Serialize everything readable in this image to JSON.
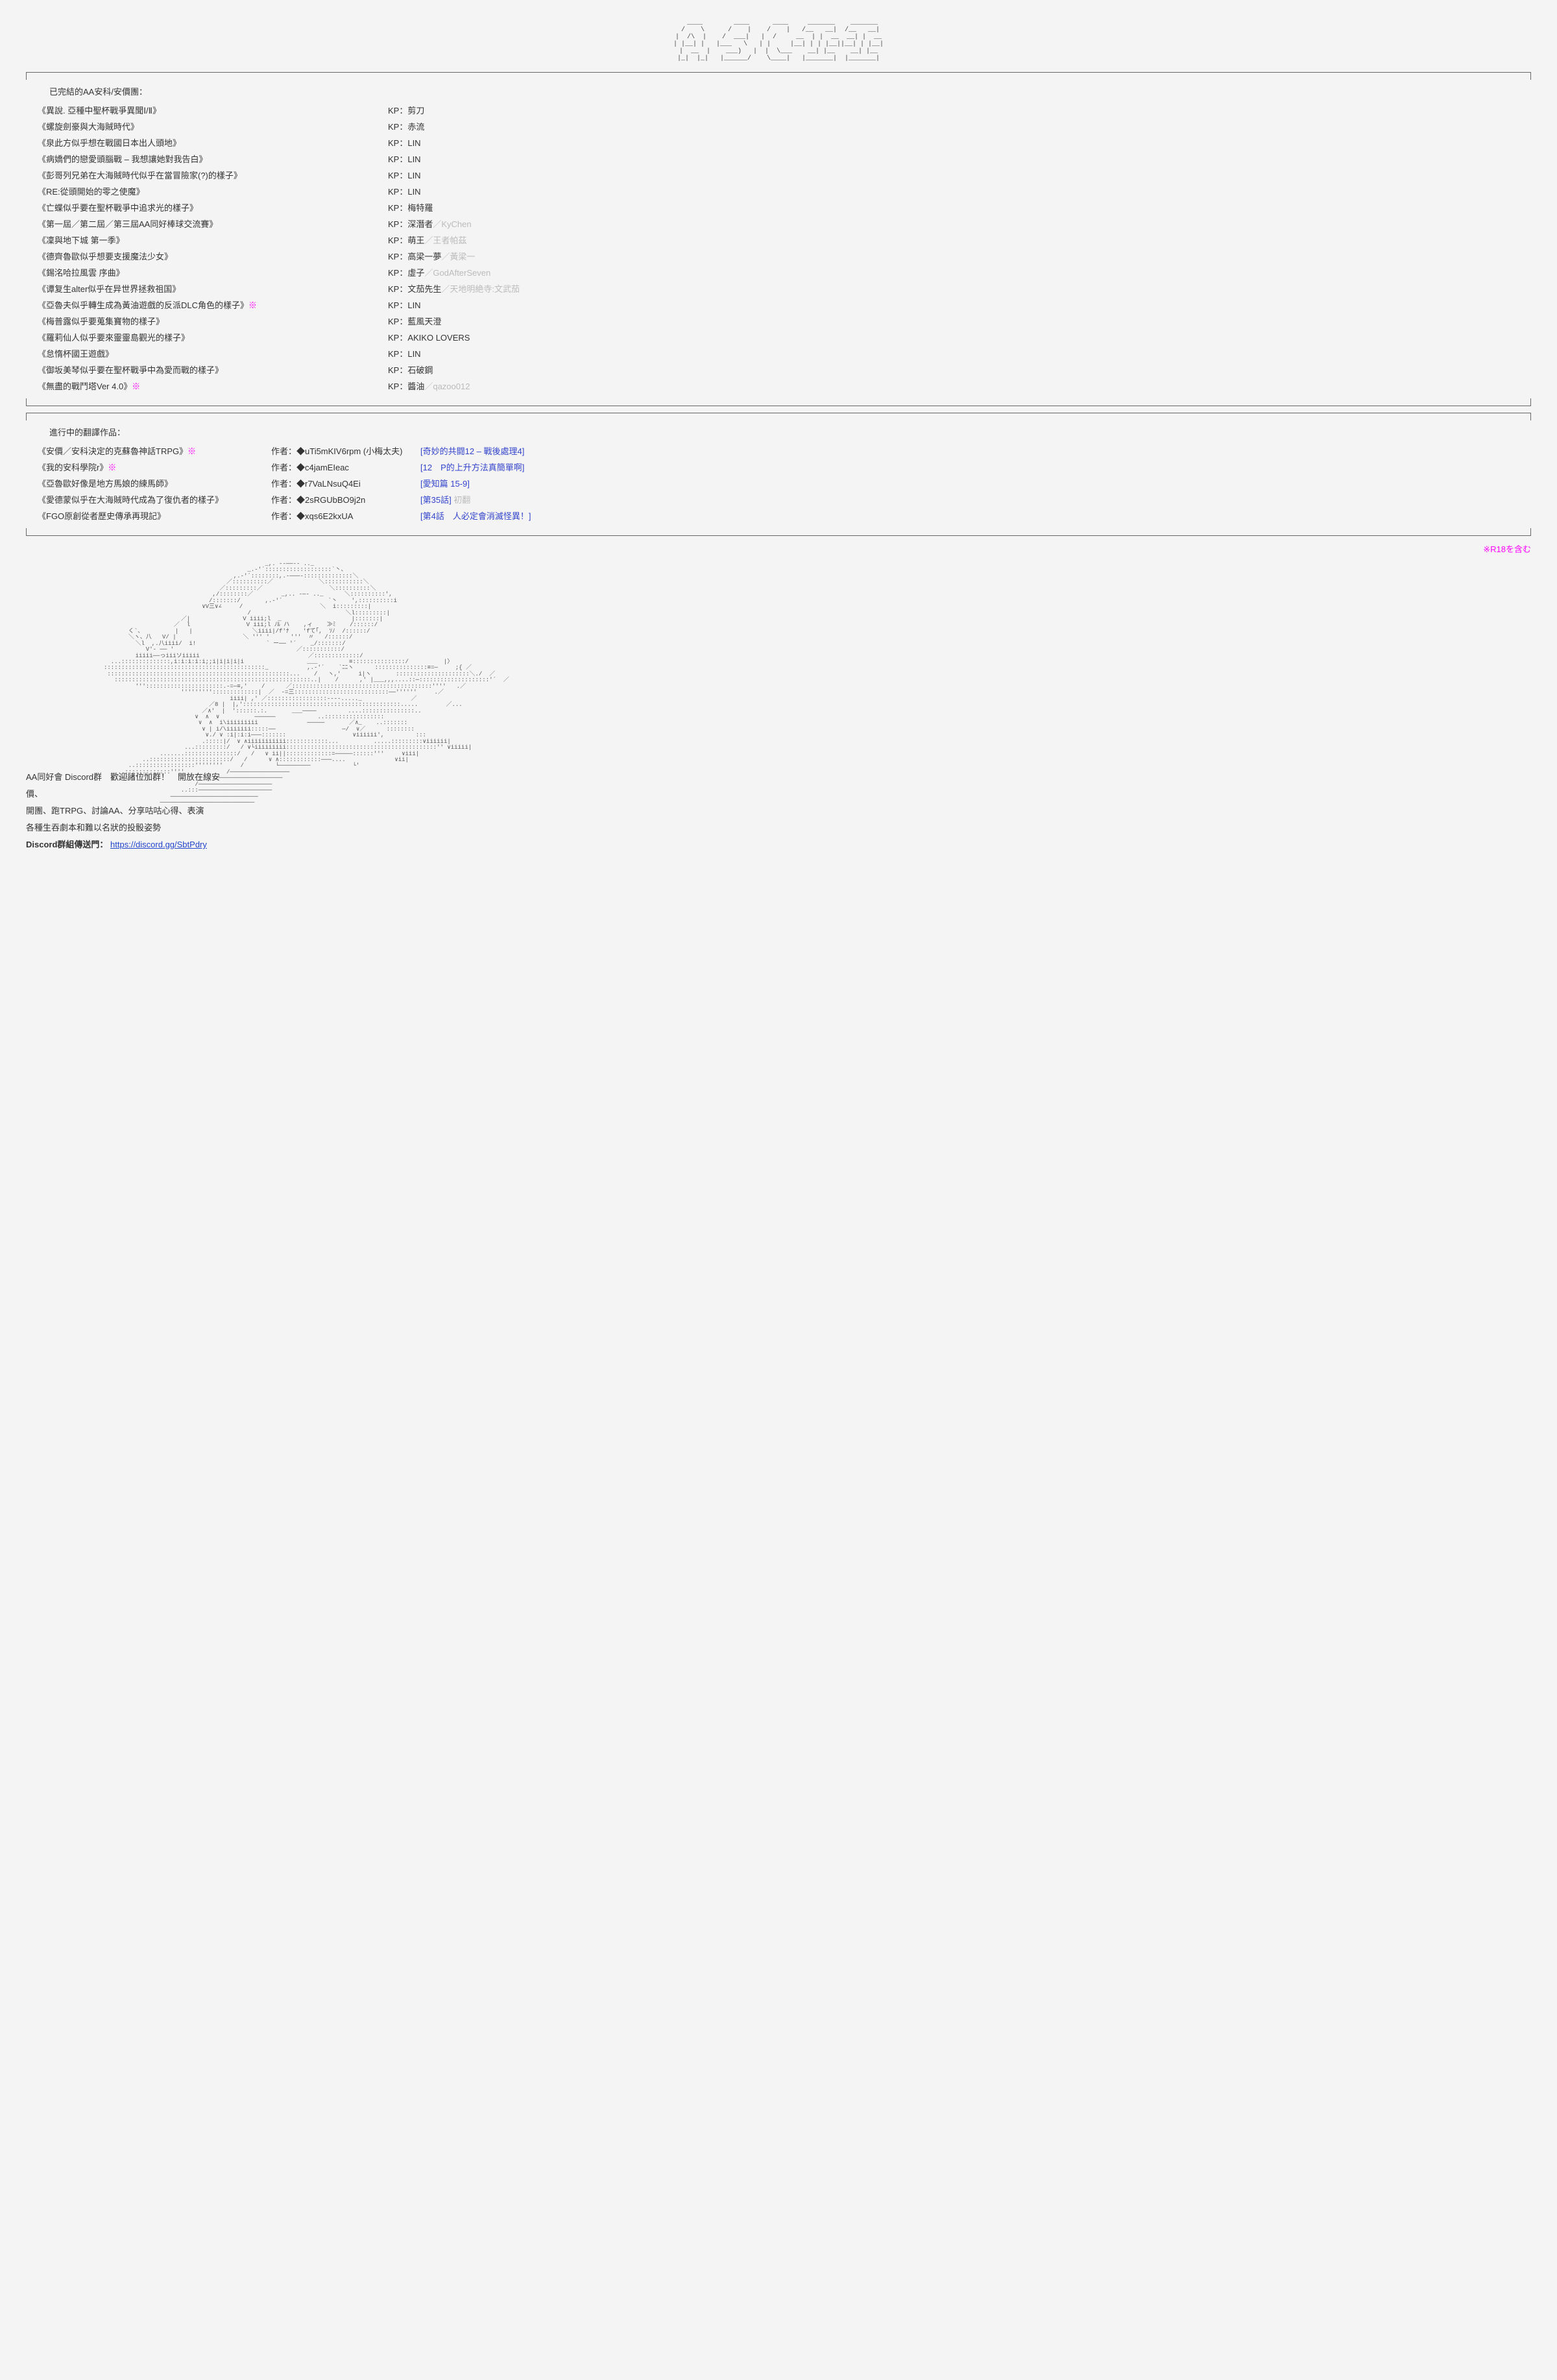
{
  "header_ascii": "   ___    ___   ___   ___   ___ \n  |   |  |     |       |     |  \n  |---|  |---  |       |     |  \n  |   |  |___| |___   _|_   _|_ ",
  "section1": {
    "title": "已完結的AA安科/安價團：",
    "items": [
      {
        "title": "《異說. 亞種中聖杯戰爭異聞Ⅰ/Ⅱ》",
        "r18": false,
        "kp": "KP：剪刀",
        "alt": ""
      },
      {
        "title": "《螺旋劍豪與大海賊時代》",
        "r18": false,
        "kp": "KP：赤流",
        "alt": ""
      },
      {
        "title": "《泉此方似乎想在戰國日本出人頭地》",
        "r18": false,
        "kp": "KP：LIN",
        "alt": ""
      },
      {
        "title": "《病嬌們的戀愛頭腦戰 – 我想讓她對我告白》",
        "r18": false,
        "kp": "KP：LIN",
        "alt": ""
      },
      {
        "title": "《彭哥列兄弟在大海賊時代似乎在當冒險家(?)的樣子》",
        "r18": false,
        "kp": "KP：LIN",
        "alt": ""
      },
      {
        "title": "《RE:從頭開始的零之使魔》",
        "r18": false,
        "kp": "KP：LIN",
        "alt": ""
      },
      {
        "title": "《亡蝶似乎要在聖杯戰爭中追求光的樣子》",
        "r18": false,
        "kp": "KP：梅特羅",
        "alt": ""
      },
      {
        "title": "《第一屆／第二屆／第三屆AA同好棒球交流賽》",
        "r18": false,
        "kp": "KP：深潛者",
        "alt": "／KyChen"
      },
      {
        "title": "《凜與地下城 第一季》",
        "r18": false,
        "kp": "KP：萌王",
        "alt": "／王者帕茲"
      },
      {
        "title": "《德齊魯歐似乎想要支援魔法少女》",
        "r18": false,
        "kp": "KP：高梁一夢",
        "alt": "／黃梁一"
      },
      {
        "title": "《錫洺哈拉風雲 序曲》",
        "r18": false,
        "kp": "KP：虛子",
        "alt": "／GodAfterSeven"
      },
      {
        "title": "《谭复生alter似乎在异世界拯救祖国》",
        "r18": false,
        "kp": "KP：文茄先生",
        "alt": "／天地明絶寺:文武茄"
      },
      {
        "title": "《亞魯夫似乎轉生成為黃油遊戲的反派DLC角色的樣子》",
        "r18": true,
        "kp": "KP：LIN",
        "alt": ""
      },
      {
        "title": "《梅普露似乎要蒐集寶物的樣子》",
        "r18": false,
        "kp": "KP：藍風天澄",
        "alt": ""
      },
      {
        "title": "《羅莉仙人似乎要來靈靈島觀光的樣子》",
        "r18": false,
        "kp": "KP：AKIKO LOVERS",
        "alt": ""
      },
      {
        "title": "《怠惰杯國王遊戲》",
        "r18": false,
        "kp": "KP：LIN",
        "alt": ""
      },
      {
        "title": "《御坂美琴似乎要在聖杯戰爭中為愛而戰的樣子》",
        "r18": false,
        "kp": "KP：石破鋼",
        "alt": ""
      },
      {
        "title": "《無盡的戰鬥塔Ver 4.0》",
        "r18": true,
        "kp": "KP：醬油",
        "alt": "／qazoo012"
      }
    ]
  },
  "section2": {
    "title": "進行中的翻譯作品：",
    "items": [
      {
        "title": "《安價／安科決定的克蘇魯神話TRPG》",
        "r18": true,
        "author": "作者：◆uTi5mKIV6rpm (小梅太夫)",
        "link": "[奇妙的共闘12 – 戰後處理4]",
        "note": ""
      },
      {
        "title": "《我的安科學院r》",
        "r18": true,
        "author": "作者：◆c4jamEIeac",
        "link": "[12　P的上升方法真簡單啊]",
        "note": ""
      },
      {
        "title": "《亞魯歐好像是地方馬娘的練馬師》",
        "r18": false,
        "author": "作者：◆r7VaLNsuQ4Ei",
        "link": "[愛知篇 15-9]",
        "note": ""
      },
      {
        "title": "《愛德蒙似乎在大海賊時代成為了復仇者的樣子》",
        "r18": false,
        "author": "作者：◆2sRGUbBO9j2n",
        "link": "[第35話]",
        "note": " 初翻"
      },
      {
        "title": "《FGO原創從者歷史傳承再現記》",
        "r18": false,
        "author": "作者：◆xqs6E2kxUA",
        "link": "[第4話　人必定會消滅怪異！]",
        "note": ""
      }
    ]
  },
  "r18_note": "※R18を含む",
  "discord": {
    "line1": "AA同好會 Discord群　歡迎諸位加群！　開放在線安價、",
    "line2": "開團、跑TRPG、討論AA、分享咕咕心得、表演",
    "line3": "各種生吞劇本和難以名狀的投骰姿勢",
    "line4_label": "Discord群組傳送門：",
    "link_text": "https://discord.gg/SbtPdry"
  },
  "ascii_art": "                                              _,. --──-- .._\n                                         _.-'´:::::::::::::::::::`丶、\n                                     ,.-'´::::::::,.-───-::::::::::::::＼\n                                   ／::::::::::／             ＼:::::::::::＼\n                                 ／:::::::::／                   ＼::::::::::＼\n                               ,/::::::::／        _,.. -─- .._      ＼::::::::::',\n                              /:::::::/       ,.-'´             `丶    ',::::::::::i\n                            ∨V三∨∠     /                      ＼  i:::::::::|\n                                         /                           ＼l:::::::::|\n                      ／|               V iiii;l  _                    |:::::::|\n                    ／  l                V iii;l ﾉﾙ ハ    ,ィ    ≫ﾐ    /::::::/\n       く`、         |   |                 ＼iiii|/f'ﾅ    'fて｢,  ｿﾉ  /::::::/\n       ＼ヽ、八   V/ |                   ＼ ''' '      '''  〃   /::::::/\n         ＼l  ,.八iiii/  i!                    ` ー── '´    _/:::::::/\n            V'- ── '                                   ／:::::::::::/\n         iiiii──っiiiソiiiii                               ／:::::::::::::/\n  ...::::::::::::::,i:i:i:i:i;;i|i|i|i|i                  ___         ≡:::::::::::::::/          |〉\n::::::::::::::::::::::::::::::::::::::::::::::_           ,.-'´    `ﾆﾆヽ      :::::::::::::::≡=─     ;{ ／\n ::::::::::::::::::::::::::::::::::::::::::::::::::::...    /   ヽ,'     i|ヽ       :::::::::::::::::::::＼./  ／\n   ::::::::::::::::::::::::::::::::::::::::::::::::::::::::..|    /      ,' |___,,,....::─::::::::::::::::::::'´  ／\n         '''::::::::::::::::::::::.-=─≡,'    /      ／::::::::::::::::::::::::::::::::::::::::''''   .／\n                      ''''''''':::::::::::::|  ／  -=三:::::::::::::::::::::::::::──''''''     .／\n                                    iiii| ,' ／:::::::::::::::::----....._              ／\n                              ／8 |  |,':::::::::::::::::::::::::::::::::::::::::::::.....        ／...\n                            ／∧'  |  '::::::.:.       ___────         ....:::::::::::::::..\n                          ∨  ∧  ∨          ──────            ..:::::::::::::::::\n                           ∨  ∧  i\\iiiiiiiii              ─────       ／∧_    ..:::::::\n                            ∨ | i/\\iiiiiii:::::──                   ─/  ∨／      ::::::::\n                             ∨./ ∨ :i|:i:i───:::::::                   ∨iiiiii',         :::\n                            .:::::|/  ∨ ∧iiiiiiiiiii::::::::::::...          .....:::::::::∨iiiiii|\n                       ...:::::::::/   / ∨└iiiiiiiii:::::::::::::::::::::::::::::::::::::::::::'' ∨iiiii|\n                .......:::::::::::::::/   /   ∨ ii||:::::::::::::=─────::::::'''     ∨iii|\n           ..:::::::::::::::::::::::/   /      ∨ ∧::::::::::::───....              ∨ii|\n       ..:::::::::::::::::''''''''     /         └─────────            └'\n   ...:::::::::::::''''            /─────────────────\n  :::::::''''                  /───────────────────\n                          /─────────────────────\n                      ..:::─────────────────────\n                   ─────────────────────────\n                ───────────────────────────"
}
